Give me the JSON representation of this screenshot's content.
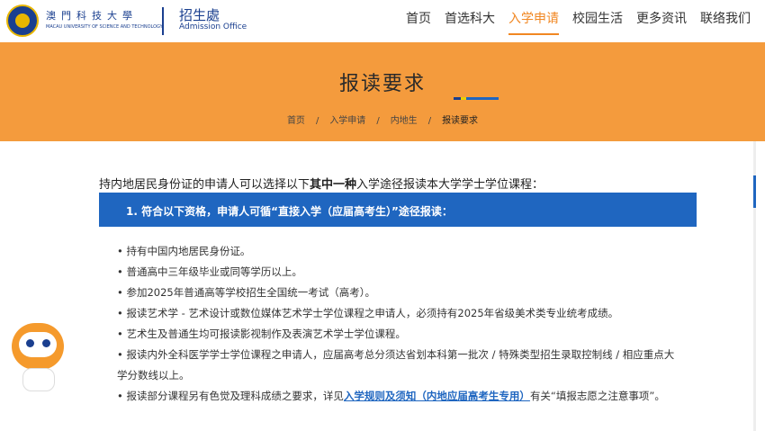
{
  "header": {
    "uni_name_cn": "澳門科技大學",
    "uni_name_en": "MACAU UNIVERSITY OF SCIENCE AND TECHNOLOGY",
    "office_cn": "招生處",
    "office_en": "Admission Office"
  },
  "nav": {
    "items": [
      "首页",
      "首选科大",
      "入学申请",
      "校园生活",
      "更多资讯",
      "联络我们"
    ],
    "active_index": 2
  },
  "banner": {
    "title": "报读要求",
    "breadcrumb": [
      "首页",
      "入学申请",
      "内地生",
      "报读要求"
    ],
    "separator": "/"
  },
  "content": {
    "intro_prefix": "持内地居民身份证的申请人可以选择以下",
    "intro_bold": "其中一种",
    "intro_suffix": "入学途径报读本大学学士学位课程：",
    "section_title": "1. 符合以下资格，申请人可循“直接入学（应届高考生）”途径报读：",
    "bullets": [
      "• 持有中国内地居民身份证。",
      "• 普通高中三年级毕业或同等学历以上。",
      "• 参加2025年普通高等学校招生全国统一考试（高考）。",
      "• 报读艺术学 - 艺术设计或数位媒体艺术学士学位课程之申请人，必须持有2025年省级美术类专业统考成绩。",
      "• 艺术生及普通生均可报读影视制作及表演艺术学士学位课程。",
      "• 报读内外全科医学学士学位课程之申请人，应届高考总分须达省划本科第一批次 / 特殊类型招生录取控制线 / 相应重点大学分数线以上。"
    ],
    "last_bullet_prefix": "• 报读部分课程另有色觉及理科成绩之要求，详见",
    "last_bullet_link": "入学规则及须知（内地应届高考生专用）",
    "last_bullet_suffix": "有关“填报志愿之注意事项”。"
  },
  "colors": {
    "accent": "#f18722",
    "banner": "#f49b3d",
    "primary": "#1f66c0",
    "brand": "#1a3f8f"
  },
  "icons": {
    "logo": "university-seal-icon",
    "assistant": "robot-assistant-icon"
  }
}
